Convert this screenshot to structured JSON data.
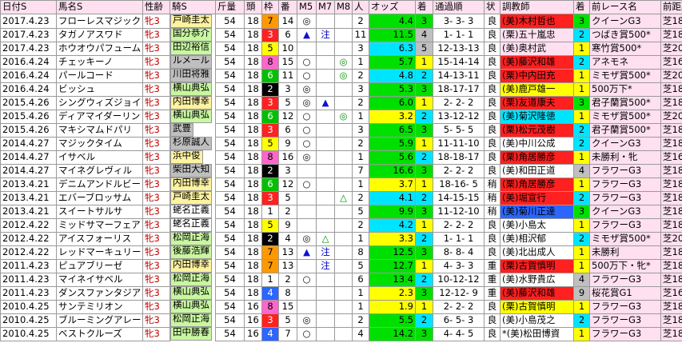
{
  "headers": [
    "日付S",
    "馬名S",
    "性齢",
    "騎S",
    "斤量",
    "頭",
    "枠",
    "番",
    "M5",
    "M7",
    "M8",
    "人",
    "オッズ",
    "着",
    "通過順",
    "状",
    "調教師",
    "着",
    "前レース名",
    "前距離",
    "1"
  ],
  "colors": {
    "header_bg": "#ffe0f0",
    "rider_bg": "#c8f7a0",
    "trainer_bg": "#ffe0f0",
    "race_bg": "#ffe0f0",
    "dist_bg": "#ffe0f0",
    "waku1": "#ffffff",
    "waku2": "#000000",
    "waku3": "#ff2020",
    "waku4": "#2a66ff",
    "waku5": "#ffff00",
    "waku6": "#00c000",
    "waku7": "#ff9900",
    "waku8": "#ff66cc",
    "fav1": "#ffff00",
    "fav2": "#00e5ff",
    "fav3": "#00e000",
    "rank_lo": "#cfcfcf",
    "gray": "#bfbfbf",
    "white": "#ffffff"
  },
  "rows": [
    {
      "date": "2017.4.23",
      "horse": "フローレスマジック",
      "sa": "牝3",
      "rider": "戸崎圭太",
      "rbg": "#fff3a0",
      "kin": "54",
      "tou": "18",
      "waku": "7",
      "wc": "#ff9900",
      "ban": "14",
      "m5": "◎",
      "m7": "",
      "m8": "",
      "nin": "2",
      "odds": "4.4",
      "obg": "#00e000",
      "chaku": "3",
      "cbg": "#00e000",
      "tsuka": "3- 3- 3",
      "jo": "良",
      "trainer": "(美)木村哲也",
      "tbg": "#ff2020",
      "pchaku": "3",
      "pcbg": "#00e000",
      "prace": "クイーンG3",
      "pdist": "芝1800",
      "pbg": "#ffe0f0",
      "pcbg2": "#ffe0f0"
    },
    {
      "date": "2017.4.23",
      "horse": "タガノアスワド",
      "sa": "牝3",
      "rider": "国分恭介",
      "rbg": "#c8f7a0",
      "kin": "54",
      "tou": "18",
      "waku": "3",
      "wc": "#ff2020",
      "ban": "6",
      "m5": "▲",
      "m7": "注",
      "m8": "",
      "nin": "11",
      "odds": "11.5",
      "obg": "#00e000",
      "chaku": "4",
      "cbg": "#bfbfbf",
      "tsuka": "1- 1- 1",
      "jo": "良",
      "trainer": "(栗)五十嵐忠",
      "tbg": "#ffe0f0",
      "pchaku": "2",
      "pcbg": "#00e5ff",
      "prace": "つばき賞500*",
      "pdist": "芝1800",
      "pbg": "#ffe0f0",
      "pcbg2": "#ffe0f0"
    },
    {
      "date": "2017.4.23",
      "horse": "ホウオウパフューム",
      "sa": "牝3",
      "rider": "田辺裕信",
      "rbg": "#c8f7a0",
      "kin": "54",
      "tou": "18",
      "waku": "5",
      "wc": "#ffff00",
      "ban": "10",
      "m5": "",
      "m7": "",
      "m8": "",
      "nin": "3",
      "odds": "6.3",
      "obg": "#00e5ff",
      "chaku": "5",
      "cbg": "#bfbfbf",
      "tsuka": "12-13-13",
      "jo": "良",
      "trainer": "(美)奥村武",
      "tbg": "#ffe0f0",
      "pchaku": "1",
      "pcbg": "#ffff00",
      "prace": "寒竹賞500*",
      "pdist": "芝2000",
      "pbg": "#ffe0f0",
      "pcbg2": "#ffe0f0"
    },
    {
      "date": "2016.4.24",
      "horse": "チェッキーノ",
      "sa": "牝3",
      "rider": "ルメール",
      "rbg": "#bfbfbf",
      "kin": "54",
      "tou": "18",
      "waku": "8",
      "wc": "#ff66cc",
      "ban": "15",
      "m5": "○",
      "m7": "",
      "m8": "◎",
      "nin": "1",
      "odds": "5.7",
      "obg": "#00e000",
      "chaku": "1",
      "cbg": "#ffff00",
      "tsuka": "15-14-14",
      "jo": "良",
      "trainer": "(美)藤沢和雄",
      "tbg": "#ff2020",
      "pchaku": "2",
      "pcbg": "#00e5ff",
      "prace": "アネモネ",
      "pdist": "芝1600",
      "pbg": "#ffe0f0",
      "pcbg2": "#ffe0f0"
    },
    {
      "date": "2016.4.24",
      "horse": "パールコード",
      "sa": "牝3",
      "rider": "川田将雅",
      "rbg": "#bfbfbf",
      "kin": "54",
      "tou": "18",
      "waku": "6",
      "wc": "#00c000",
      "ban": "11",
      "m5": "○",
      "m7": "",
      "m8": "◎",
      "nin": "2",
      "odds": "4.8",
      "obg": "#00e5ff",
      "chaku": "2",
      "cbg": "#00e5ff",
      "tsuka": "14-13-11",
      "jo": "良",
      "trainer": "(栗)中内田充",
      "tbg": "#ff2020",
      "pchaku": "1",
      "pcbg": "#ffff00",
      "prace": "ミモザ賞500*",
      "pdist": "芝2000",
      "pbg": "#ffe0f0",
      "pcbg2": "#ffe0f0"
    },
    {
      "date": "2016.4.24",
      "horse": "ビッシュ",
      "sa": "牝3",
      "rider": "横山典弘",
      "rbg": "#c8f7a0",
      "kin": "54",
      "tou": "18",
      "waku": "2",
      "wc": "#000000",
      "ban": "3",
      "m5": "◎",
      "m7": "",
      "m8": "",
      "nin": "3",
      "odds": "5.3",
      "obg": "#00e000",
      "chaku": "3",
      "cbg": "#00e000",
      "tsuka": "18-17-17",
      "jo": "良",
      "trainer": "(美)鹿戸雄一",
      "tbg": "#ffff00",
      "pchaku": "1",
      "pcbg": "#ffff00",
      "prace": "500万下*",
      "pdist": "芝1800",
      "pbg": "#ffe0f0",
      "pcbg2": "#ffe0f0"
    },
    {
      "date": "2015.4.26",
      "horse": "シングウィズジョイ",
      "sa": "牝3",
      "rider": "内田博幸",
      "rbg": "#fff3a0",
      "kin": "54",
      "tou": "18",
      "waku": "3",
      "wc": "#ff2020",
      "ban": "5",
      "m5": "◎",
      "m7": "▲",
      "m8": "",
      "nin": "2",
      "odds": "6.0",
      "obg": "#00e000",
      "chaku": "1",
      "cbg": "#ffff00",
      "tsuka": "2- 2- 2",
      "jo": "良",
      "trainer": "(栗)友道康夫",
      "tbg": "#ff2020",
      "pchaku": "3",
      "pcbg": "#00e000",
      "prace": "君子蘭賞500*",
      "pdist": "芝1800",
      "pbg": "#ffe0f0",
      "pcbg2": "#ffe0f0"
    },
    {
      "date": "2015.4.26",
      "horse": "ディアマイダーリン",
      "sa": "牝3",
      "rider": "横山典弘",
      "rbg": "#c8f7a0",
      "kin": "54",
      "tou": "18",
      "waku": "6",
      "wc": "#00c000",
      "ban": "12",
      "m5": "○",
      "m7": "",
      "m8": "◎",
      "nin": "1",
      "odds": "3.2",
      "obg": "#ffff00",
      "chaku": "2",
      "cbg": "#00e5ff",
      "tsuka": "13-12-12",
      "jo": "良",
      "trainer": "(美)菊沢隆徳",
      "tbg": "#00e5ff",
      "pchaku": "1",
      "pcbg": "#ffff00",
      "prace": "ミモザ賞500*",
      "pdist": "芝2000",
      "pbg": "#ffe0f0",
      "pcbg2": "#ffe0f0"
    },
    {
      "date": "2015.4.26",
      "horse": "マキシマムドパリ",
      "sa": "牝3",
      "rider": "武豊",
      "rbg": "#bfbfbf",
      "kin": "54",
      "tou": "18",
      "waku": "3",
      "wc": "#ff2020",
      "ban": "6",
      "m5": "○",
      "m7": "",
      "m8": "",
      "nin": "3",
      "odds": "6.5",
      "obg": "#00e000",
      "chaku": "3",
      "cbg": "#00e000",
      "tsuka": "5- 5- 5",
      "jo": "良",
      "trainer": "(栗)松元茂樹",
      "tbg": "#ff2020",
      "pchaku": "2",
      "pcbg": "#00e5ff",
      "prace": "君子蘭賞500*",
      "pdist": "芝1800",
      "pbg": "#ffe0f0",
      "pcbg2": "#ffe0f0"
    },
    {
      "date": "2014.4.27",
      "horse": "マジックタイム",
      "sa": "牝3",
      "rider": "杉原誠人",
      "rbg": "#bfbfbf",
      "kin": "54",
      "tou": "18",
      "waku": "5",
      "wc": "#ffff00",
      "ban": "9",
      "m5": "○",
      "m7": "",
      "m8": "",
      "nin": "2",
      "odds": "5.9",
      "obg": "#00e000",
      "chaku": "1",
      "cbg": "#ffff00",
      "tsuka": "11-11-10",
      "jo": "良",
      "trainer": "(美)中川公成",
      "tbg": "#ffffff",
      "pchaku": "2",
      "pcbg": "#00e5ff",
      "prace": "クイーンG3",
      "pdist": "芝1800",
      "pbg": "#ffe0f0",
      "pcbg2": "#ffe0f0"
    },
    {
      "date": "2014.4.27",
      "horse": "イサベル",
      "sa": "牝3",
      "rider": "浜中俊",
      "rbg": "#fff3a0",
      "kin": "54",
      "tou": "18",
      "waku": "8",
      "wc": "#ff66cc",
      "ban": "16",
      "m5": "◎",
      "m7": "",
      "m8": "",
      "nin": "1",
      "odds": "5.6",
      "obg": "#00e000",
      "chaku": "2",
      "cbg": "#00e5ff",
      "tsuka": "18-18-17",
      "jo": "良",
      "trainer": "(栗)角居勝彦",
      "tbg": "#ff2020",
      "pchaku": "1",
      "pcbg": "#ffff00",
      "prace": "未勝利・牝",
      "pdist": "芝1600",
      "pbg": "#ffe0f0",
      "pcbg2": "#ffe0f0"
    },
    {
      "date": "2014.4.27",
      "horse": "マイネグレヴィル",
      "sa": "牝3",
      "rider": "柴田大知",
      "rbg": "#bfbfbf",
      "kin": "54",
      "tou": "18",
      "waku": "2",
      "wc": "#000000",
      "ban": "3",
      "m5": "",
      "m7": "",
      "m8": "",
      "nin": "7",
      "odds": "16.6",
      "obg": "#00e000",
      "chaku": "3",
      "cbg": "#00e000",
      "tsuka": "2- 2- 2",
      "jo": "良",
      "trainer": "(美)和田正道",
      "tbg": "#ffffff",
      "pchaku": "4",
      "pcbg": "#bfbfbf",
      "prace": "フラワーG3",
      "pdist": "芝1800",
      "pbg": "#ffe0f0",
      "pcbg2": "#ffe0f0"
    },
    {
      "date": "2013.4.21",
      "horse": "デニムアンドルビー",
      "sa": "牝3",
      "rider": "内田博幸",
      "rbg": "#fff3a0",
      "kin": "54",
      "tou": "18",
      "waku": "6",
      "wc": "#00c000",
      "ban": "12",
      "m5": "○",
      "m7": "",
      "m8": "",
      "nin": "1",
      "odds": "3.7",
      "obg": "#ffff00",
      "chaku": "1",
      "cbg": "#ffff00",
      "tsuka": "18-16- 5",
      "jo": "稍",
      "trainer": "(栗)角居勝彦",
      "tbg": "#ff2020",
      "pchaku": "1",
      "pcbg": "#ffff00",
      "prace": "フラワーG3",
      "pdist": "芝1800",
      "pbg": "#ffe0f0",
      "pcbg2": "#ffe0f0"
    },
    {
      "date": "2013.4.21",
      "horse": "エバーブロッサム",
      "sa": "牝3",
      "rider": "戸崎圭太",
      "rbg": "#fff3a0",
      "kin": "54",
      "tou": "18",
      "waku": "3",
      "wc": "#ff2020",
      "ban": "5",
      "m5": "",
      "m7": "",
      "m8": "△",
      "nin": "2",
      "odds": "4.1",
      "obg": "#00e5ff",
      "chaku": "2",
      "cbg": "#00e5ff",
      "tsuka": "14-15-15",
      "jo": "稍",
      "trainer": "(美)堀宣行",
      "tbg": "#ff2020",
      "pchaku": "2",
      "pcbg": "#00e5ff",
      "prace": "フラワーG3",
      "pdist": "芝1800",
      "pbg": "#ffe0f0",
      "pcbg2": "#ffe0f0"
    },
    {
      "date": "2013.4.21",
      "horse": "スイートサルサ",
      "sa": "牝3",
      "rider": "蛯名正義",
      "rbg": "#ffffff",
      "kin": "54",
      "tou": "18",
      "waku": "1",
      "wc": "#ffffff",
      "ban": "2",
      "m5": "",
      "m7": "",
      "m8": "",
      "nin": "5",
      "odds": "9.9",
      "obg": "#00e000",
      "chaku": "3",
      "cbg": "#00e000",
      "tsuka": "11-12-10",
      "jo": "稍",
      "trainer": "(美)菊川正達",
      "tbg": "#2a66ff",
      "pchaku": "3",
      "pcbg": "#00e000",
      "prace": "クイーンG3",
      "pdist": "芝1800",
      "pbg": "#ffe0f0",
      "pcbg2": "#ffe0f0"
    },
    {
      "date": "2012.4.22",
      "horse": "ミッドサマーフェア",
      "sa": "牝3",
      "rider": "蛯名正義",
      "rbg": "#ffffff",
      "kin": "54",
      "tou": "18",
      "waku": "5",
      "wc": "#ffff00",
      "ban": "9",
      "m5": "",
      "m7": "",
      "m8": "",
      "nin": "2",
      "odds": "4.2",
      "obg": "#00e5ff",
      "chaku": "1",
      "cbg": "#ffff00",
      "tsuka": "2- 2- 2",
      "jo": "良",
      "trainer": "(美)小島太",
      "tbg": "#ffffff",
      "pchaku": "1",
      "pcbg": "#ffff00",
      "prace": "フラワーG3",
      "pdist": "芝1800",
      "pbg": "#ffe0f0",
      "pcbg2": "#ffe0f0"
    },
    {
      "date": "2012.4.22",
      "horse": "アイスフォーリス",
      "sa": "牝3",
      "rider": "松岡正海",
      "rbg": "#c8f7a0",
      "kin": "54",
      "tou": "18",
      "waku": "2",
      "wc": "#000000",
      "ban": "4",
      "m5": "◎",
      "m7": "△",
      "m8": "",
      "nin": "1",
      "odds": "3.3",
      "obg": "#ffff00",
      "chaku": "2",
      "cbg": "#00e5ff",
      "tsuka": "1- 1- 1",
      "jo": "良",
      "trainer": "(美)相沢郁",
      "tbg": "#ffffff",
      "pchaku": "2",
      "pcbg": "#00e5ff",
      "prace": "ミモザ賞500*",
      "pdist": "芝2000",
      "pbg": "#ffe0f0",
      "pcbg2": "#ffe0f0"
    },
    {
      "date": "2012.4.22",
      "horse": "レッドマーキュリー",
      "sa": "牝3",
      "rider": "後藤浩輝",
      "rbg": "#c8f7a0",
      "kin": "54",
      "tou": "18",
      "waku": "7",
      "wc": "#ff9900",
      "ban": "13",
      "m5": "▲",
      "m7": "注",
      "m8": "",
      "nin": "8",
      "odds": "12.5",
      "obg": "#00e000",
      "chaku": "3",
      "cbg": "#00e000",
      "tsuka": "8- 8- 4",
      "jo": "良",
      "trainer": "(美)北出成人",
      "tbg": "#ffffff",
      "pchaku": "1",
      "pcbg": "#ffff00",
      "prace": "未勝利",
      "pdist": "芝1800",
      "pbg": "#ffe0f0",
      "pcbg2": "#ffe0f0"
    },
    {
      "date": "2011.4.23",
      "horse": "ピュアブリーゼ",
      "sa": "牝3",
      "rider": "内田博幸",
      "rbg": "#fff3a0",
      "kin": "54",
      "tou": "18",
      "waku": "7",
      "wc": "#ff9900",
      "ban": "13",
      "m5": "",
      "m7": "注",
      "m8": "",
      "nin": "5",
      "odds": "12.7",
      "obg": "#00e000",
      "chaku": "1",
      "cbg": "#ffff00",
      "tsuka": "4- 3- 3",
      "jo": "重",
      "trainer": "(栗)古賀慎明",
      "tbg": "#ff2020",
      "pchaku": "1",
      "pcbg": "#ffff00",
      "prace": "500万下・牝*",
      "pdist": "芝1800",
      "pbg": "#ffe0f0",
      "pcbg2": "#ffe0f0"
    },
    {
      "date": "2011.4.23",
      "horse": "マイネイサベル",
      "sa": "牝3",
      "rider": "松岡正海",
      "rbg": "#c8f7a0",
      "kin": "54",
      "tou": "18",
      "waku": "1",
      "wc": "#ffffff",
      "ban": "2",
      "m5": "○",
      "m7": "",
      "m8": "",
      "nin": "6",
      "odds": "13.4",
      "obg": "#00e000",
      "chaku": "2",
      "cbg": "#00e5ff",
      "tsuka": "10-12-12",
      "jo": "重",
      "trainer": "(美)水野貴広",
      "tbg": "#ffffff",
      "pchaku": "4",
      "pcbg": "#bfbfbf",
      "prace": "フラワーG3",
      "pdist": "芝1800",
      "pbg": "#ffe0f0",
      "pcbg2": "#ffe0f0"
    },
    {
      "date": "2011.4.23",
      "horse": "ダンスファンタジア",
      "sa": "牝3",
      "rider": "横山典弘",
      "rbg": "#c8f7a0",
      "kin": "54",
      "tou": "18",
      "waku": "4",
      "wc": "#2a66ff",
      "ban": "8",
      "m5": "",
      "m7": "",
      "m8": "",
      "nin": "1",
      "odds": "2.3",
      "obg": "#ffff00",
      "chaku": "3",
      "cbg": "#00e000",
      "tsuka": "12-12- 9",
      "jo": "重",
      "trainer": "(美)藤沢和雄",
      "tbg": "#ff2020",
      "pchaku": "9",
      "pcbg": "#bfbfbf",
      "prace": "桜花賞G1",
      "pdist": "芝1600",
      "pbg": "#ffe0f0",
      "pcbg2": "#ffe0f0"
    },
    {
      "date": "2010.4.25",
      "horse": "サンテミリオン",
      "sa": "牝3",
      "rider": "横山典弘",
      "rbg": "#c8f7a0",
      "kin": "54",
      "tou": "16",
      "waku": "8",
      "wc": "#ff66cc",
      "ban": "15",
      "m5": "",
      "m7": "",
      "m8": "",
      "nin": "1",
      "odds": "1.9",
      "obg": "#ffff00",
      "chaku": "1",
      "cbg": "#ffff00",
      "tsuka": "2- 2- 2",
      "jo": "良",
      "trainer": "(栗)古賀慎明",
      "tbg": "#ffff00",
      "pchaku": "1",
      "pcbg": "#ffff00",
      "prace": "フラワーG3",
      "pdist": "芝1800",
      "pbg": "#ffe0f0",
      "pcbg2": "#ffe0f0"
    },
    {
      "date": "2010.4.25",
      "horse": "ブルーミングアレー",
      "sa": "牝3",
      "rider": "松岡正海",
      "rbg": "#c8f7a0",
      "kin": "54",
      "tou": "16",
      "waku": "3",
      "wc": "#ff2020",
      "ban": "5",
      "m5": "◎",
      "m7": "",
      "m8": "",
      "nin": "2",
      "odds": "5.5",
      "obg": "#00e000",
      "chaku": "2",
      "cbg": "#00e5ff",
      "tsuka": "6- 5- 3",
      "jo": "良",
      "trainer": "(美)小島茂之",
      "tbg": "#ffffff",
      "pchaku": "2",
      "pcbg": "#00e5ff",
      "prace": "フラワーG3",
      "pdist": "芝1800",
      "pbg": "#ffe0f0",
      "pcbg2": "#ffe0f0"
    },
    {
      "date": "2010.4.25",
      "horse": "ベストクルーズ",
      "sa": "牝3",
      "rider": "田中勝春",
      "rbg": "#c8f7a0",
      "kin": "54",
      "tou": "16",
      "waku": "4",
      "wc": "#2a66ff",
      "ban": "7",
      "m5": "○",
      "m7": "",
      "m8": "",
      "nin": "4",
      "odds": "14.2",
      "obg": "#00e000",
      "chaku": "3",
      "cbg": "#00e000",
      "tsuka": "4- 4- 5",
      "jo": "良",
      "trainer": "*(美)松田博資",
      "tbg": "#ffffff",
      "pchaku": "1",
      "pcbg": "#ffff00",
      "prace": "フラワーG3",
      "pdist": "芝1800",
      "pbg": "#ffe0f0",
      "pcbg2": "#ffe0f0"
    }
  ]
}
